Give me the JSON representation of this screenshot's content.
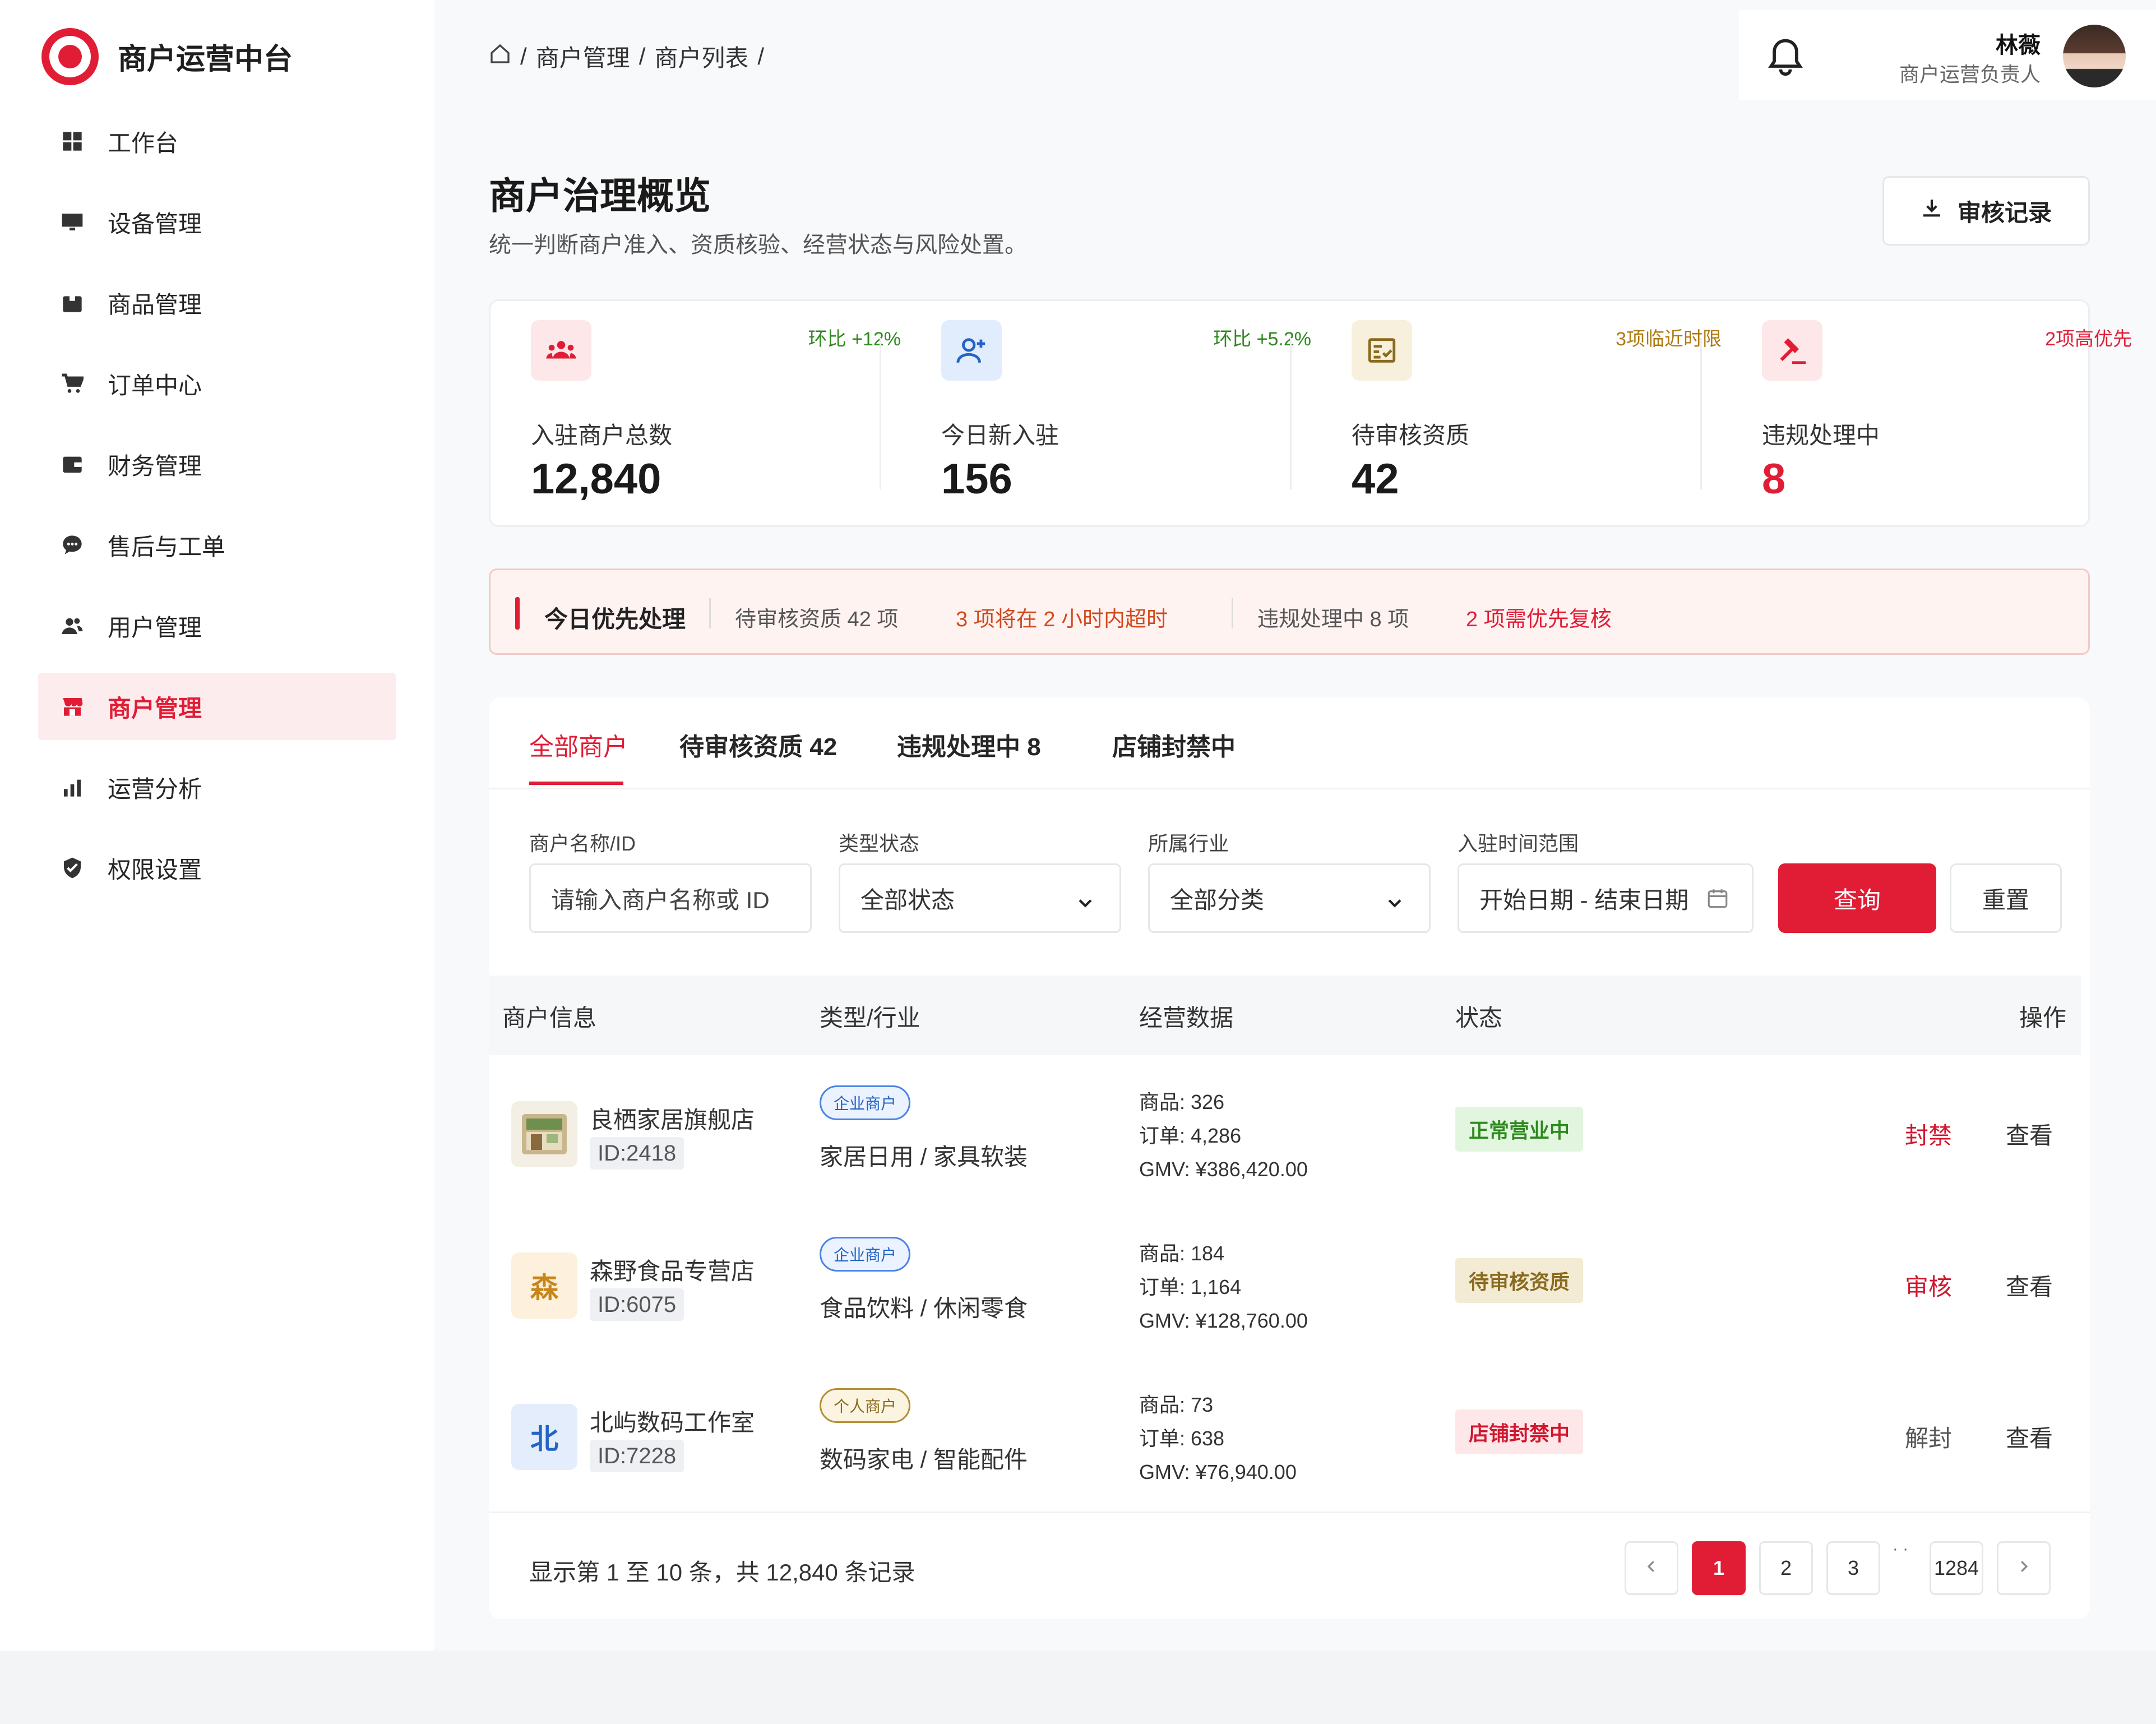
{
  "app": {
    "title": "商户运营中台"
  },
  "sidebar": {
    "items": [
      {
        "label": "工作台",
        "icon": "dashboard-icon"
      },
      {
        "label": "设备管理",
        "icon": "monitor-icon"
      },
      {
        "label": "商品管理",
        "icon": "package-icon"
      },
      {
        "label": "订单中心",
        "icon": "cart-icon"
      },
      {
        "label": "财务管理",
        "icon": "wallet-icon"
      },
      {
        "label": "售后与工单",
        "icon": "chat-icon"
      },
      {
        "label": "用户管理",
        "icon": "users-icon"
      },
      {
        "label": "商户管理",
        "icon": "store-icon",
        "active": true
      },
      {
        "label": "运营分析",
        "icon": "bar-chart-icon"
      },
      {
        "label": "权限设置",
        "icon": "shield-icon"
      }
    ]
  },
  "breadcrumb": {
    "sep": "/",
    "items": [
      "商户管理",
      "商户列表"
    ]
  },
  "user": {
    "name": "林薇",
    "role": "商户运营负责人"
  },
  "page": {
    "title": "商户治理概览",
    "subtitle": "统一判断商户准入、资质核验、经营状态与风险处置。",
    "records_button": "审核记录"
  },
  "stats": [
    {
      "label": "入驻商户总数",
      "value": "12,840",
      "trend": "环比 +12%",
      "icon": "group-icon"
    },
    {
      "label": "今日新入驻",
      "value": "156",
      "trend": "环比 +5.2%",
      "icon": "user-plus-icon"
    },
    {
      "label": "待审核资质",
      "value": "42",
      "trend": "3项临近时限",
      "icon": "checklist-icon"
    },
    {
      "label": "违规处理中",
      "value": "8",
      "trend": "2项高优先",
      "icon": "gavel-icon"
    }
  ],
  "priority": {
    "title": "今日优先处理",
    "pending": "待审核资质 42 项",
    "pending_warn": "3 项将在 2 小时内超时",
    "violations": "违规处理中 8 项",
    "violations_warn": "2 项需优先复核"
  },
  "tabs": [
    {
      "label": "全部商户",
      "active": true
    },
    {
      "label": "待审核资质 42"
    },
    {
      "label": "违规处理中 8"
    },
    {
      "label": "店铺封禁中"
    }
  ],
  "filters": {
    "name": {
      "label": "商户名称/ID",
      "placeholder": "请输入商户名称或 ID"
    },
    "status": {
      "label": "类型状态",
      "value": "全部状态"
    },
    "industry": {
      "label": "所属行业",
      "value": "全部分类"
    },
    "date": {
      "label": "入驻时间范围",
      "value": "开始日期 - 结束日期"
    },
    "query_button": "查询",
    "reset_button": "重置"
  },
  "table": {
    "columns": [
      "商户信息",
      "类型/行业",
      "经营数据",
      "状态",
      "操作"
    ],
    "rows": [
      {
        "name": "良栖家居旗舰店",
        "id": "ID:2418",
        "type": "企业商户",
        "industry": "家居日用 / 家具软装",
        "goods": "商品: 326",
        "orders": "订单: 4,286",
        "gmv": "GMV: ¥386,420.00",
        "status": "正常营业中",
        "action": "封禁",
        "view": "查看"
      },
      {
        "name": "森野食品专营店",
        "id": "ID:6075",
        "thumb": "森",
        "type": "企业商户",
        "industry": "食品饮料 / 休闲零食",
        "goods": "商品: 184",
        "orders": "订单: 1,164",
        "gmv": "GMV: ¥128,760.00",
        "status": "待审核资质",
        "action": "审核",
        "view": "查看"
      },
      {
        "name": "北屿数码工作室",
        "id": "ID:7228",
        "thumb": "北",
        "type": "个人商户",
        "industry": "数码家电 / 智能配件",
        "goods": "商品: 73",
        "orders": "订单: 638",
        "gmv": "GMV: ¥76,940.00",
        "status": "店铺封禁中",
        "action": "解封",
        "view": "查看"
      }
    ]
  },
  "pagination": {
    "summary": "显示第 1 至 10 条，共 12,840 条记录",
    "pages": [
      "1",
      "2",
      "3"
    ],
    "last": "1284",
    "ellipsis": "· ·"
  },
  "colors": {
    "primary": "#e11d36",
    "active_bg": "#fdecee"
  }
}
